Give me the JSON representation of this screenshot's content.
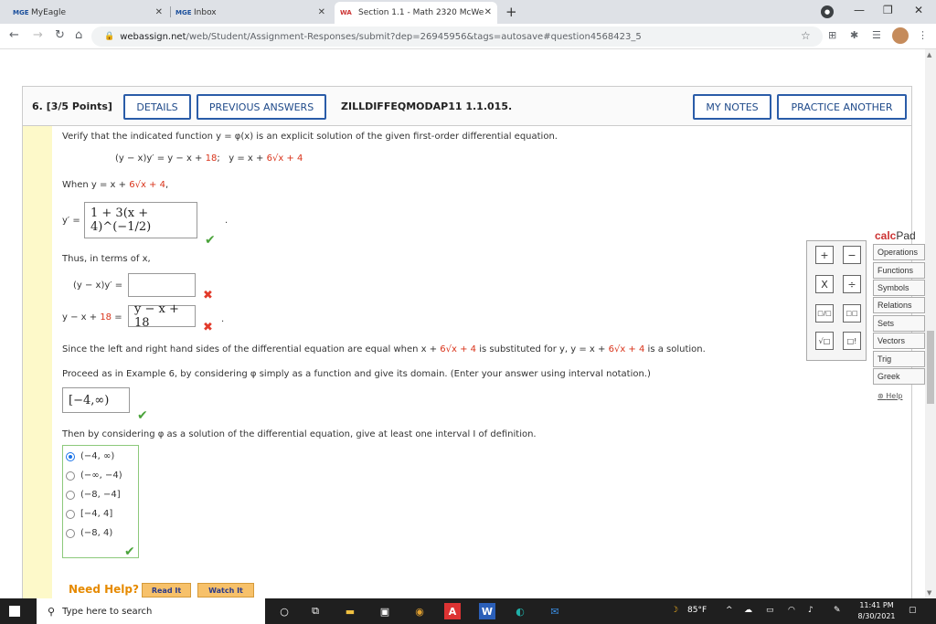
{
  "browser": {
    "tabs": [
      {
        "favicon": "MGE",
        "title": "MyEagle",
        "active": false
      },
      {
        "favicon": "MGE",
        "title": "Inbox",
        "active": false
      },
      {
        "favicon": "WA",
        "title": "Section 1.1 - Math 2320 McWe",
        "active": true
      }
    ],
    "url_host": "webassign.net",
    "url_path": "/web/Student/Assignment-Responses/submit?dep=26945956&tags=autosave#question4568423_5"
  },
  "question": {
    "number": "6.",
    "points": "[3/5 Points]",
    "buttons": {
      "details": "DETAILS",
      "previous_answers": "PREVIOUS ANSWERS",
      "my_notes": "MY NOTES",
      "practice_another": "PRACTICE ANOTHER"
    },
    "code": "ZILLDIFFEQMODAP11 1.1.015.",
    "prompt": "Verify that the indicated function y = φ(x) is an explicit solution of the given first-order differential equation.",
    "equation_left": "(y − x)y′ = y − x + ",
    "equation_left_red": "18",
    "equation_sep": ";",
    "equation_right": "y = x + ",
    "equation_right_red": "6√x + 4",
    "when_text": "When y = x + ",
    "when_red": "6√x + 4",
    "when_end": ",",
    "yprime_label": "y′ =",
    "yprime_answer": "1 + 3(x + 4)^(−1/2)",
    "thus_text": "Thus, in terms of x,",
    "lhs_label": "(y − x)y′ =",
    "lhs_answer": "",
    "rhs_label_pre": "y − x + ",
    "rhs_label_red": "18",
    "rhs_label_post": " =",
    "rhs_answer": "y − x + 18",
    "since_text_1": "Since the left and right hand sides of the differential equation are equal when x + ",
    "since_red_1": "6√x + 4",
    "since_text_2": " is substituted for y, y = x + ",
    "since_red_2": "6√x + 4",
    "since_text_3": " is a solution.",
    "proceed_text": "Proceed as in Example 6, by considering φ simply as a function and give its domain. (Enter your answer using interval notation.)",
    "domain_answer": "[−4,∞)",
    "interval_text": "Then by considering φ as a solution of the differential equation, give at least one interval I of definition.",
    "choices": [
      "(−4, ∞)",
      "(−∞, −4)",
      "(−8, −4]",
      "[−4, 4]",
      "(−8, 4)"
    ],
    "selected_choice": 0,
    "need_help": "Need Help?",
    "read_it": "Read It",
    "watch_it": "Watch It"
  },
  "calcpad": {
    "title_red": "calc",
    "title_rest": "Pad",
    "keys": [
      "+",
      "−",
      "X",
      "÷",
      "□/□",
      "□□",
      "√□",
      "□!"
    ],
    "menu": [
      "Operations",
      "Functions",
      "Symbols",
      "Relations",
      "Sets",
      "Vectors",
      "Trig",
      "Greek"
    ],
    "help": "Help"
  },
  "taskbar": {
    "search_placeholder": "Type here to search",
    "weather": "85°F",
    "time": "11:41 PM",
    "date": "8/30/2021"
  }
}
